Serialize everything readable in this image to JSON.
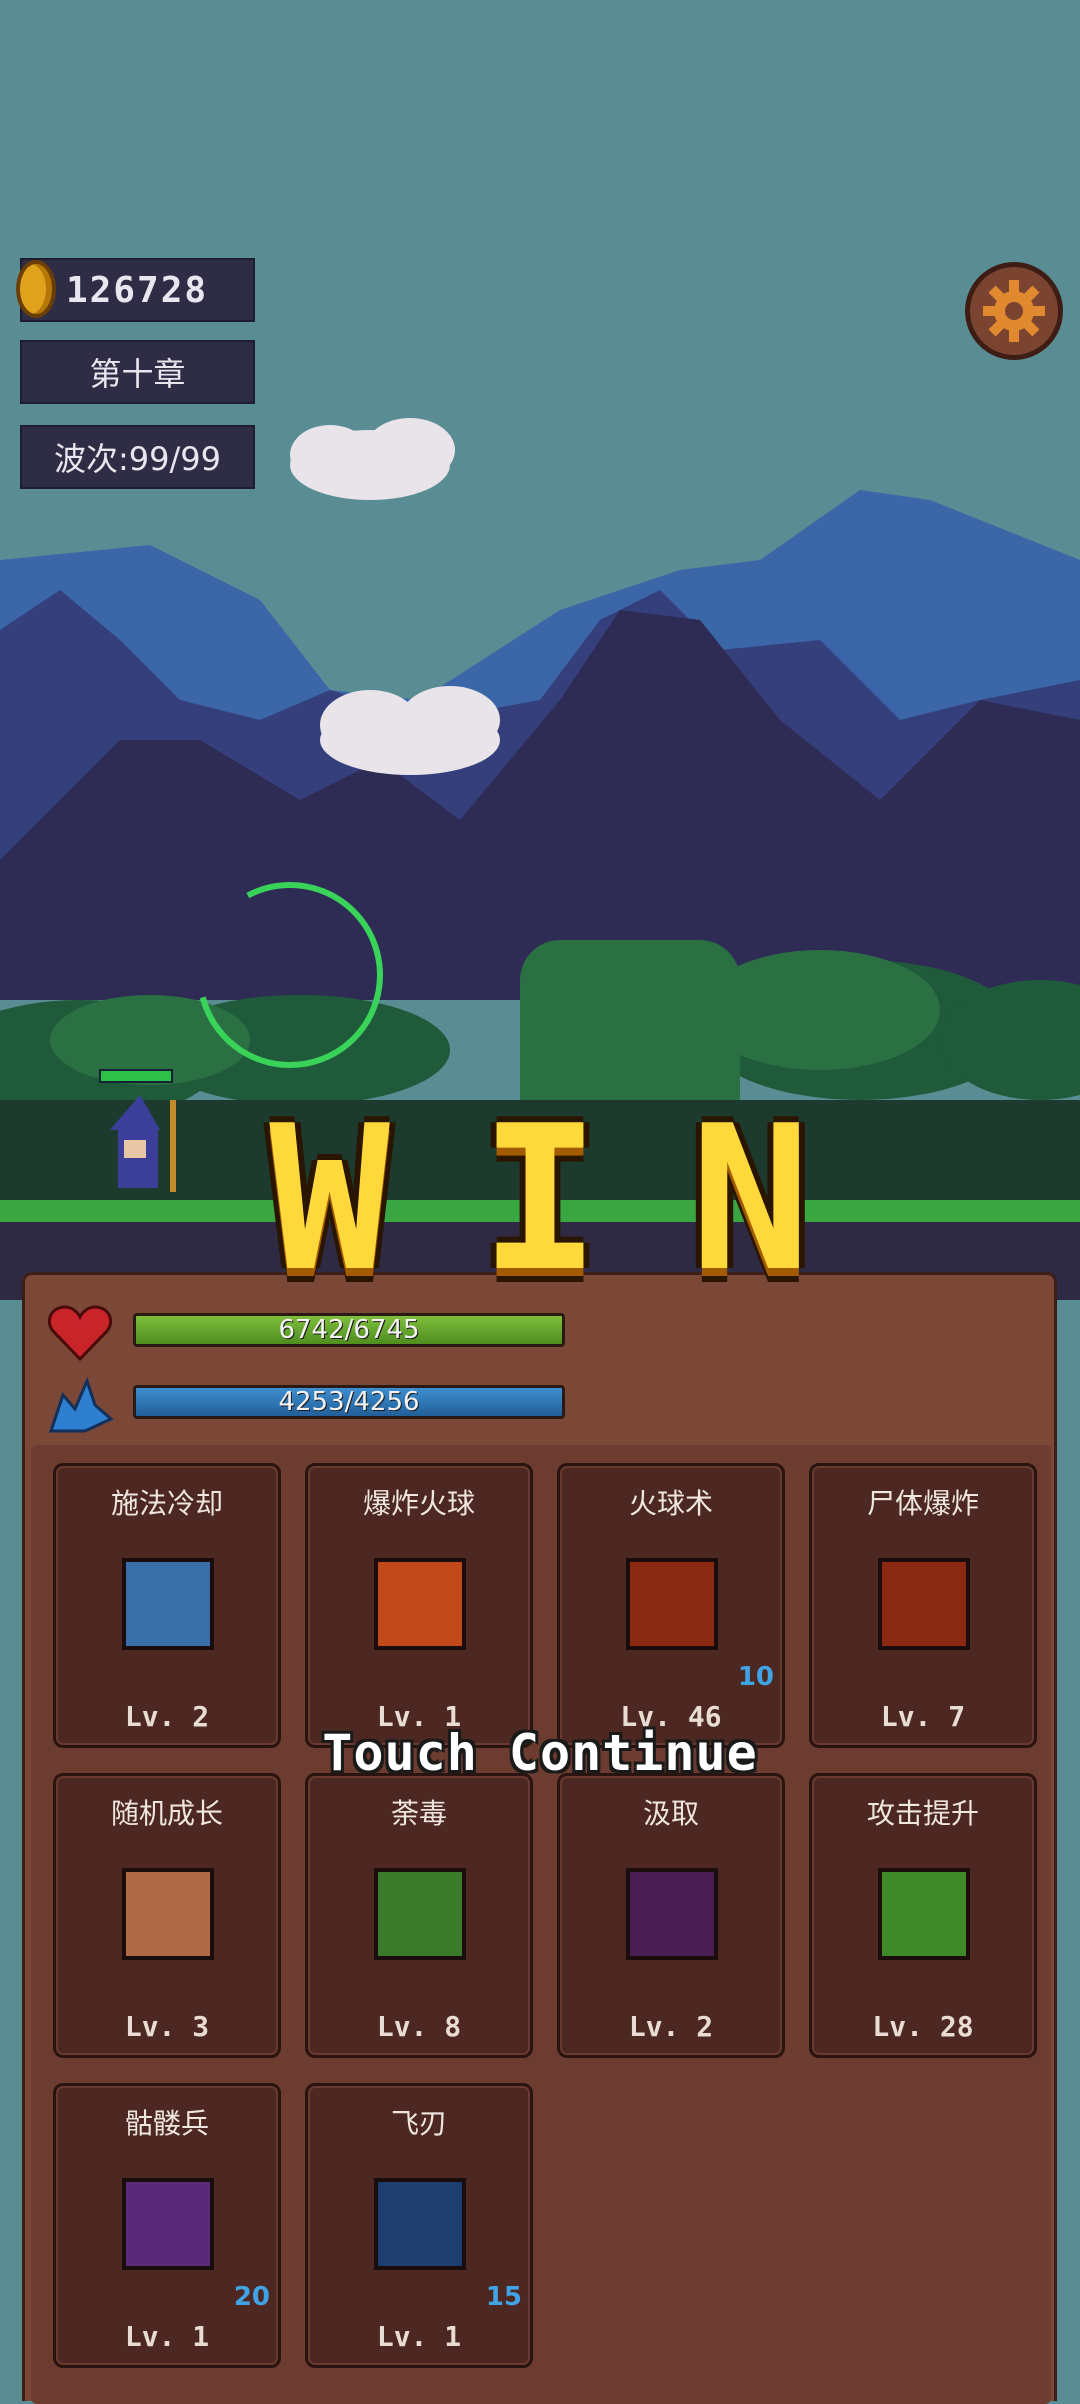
{
  "hud": {
    "coins": "126728",
    "chapter": "第十章",
    "wave": "波次:99/99"
  },
  "banner": {
    "letters": [
      "W",
      "I",
      "N"
    ]
  },
  "stats": {
    "hp": "6742/6745",
    "hp_fraction": 0.9996,
    "mp": "4253/4256",
    "mp_fraction": 0.9993
  },
  "skills": [
    {
      "name": "施法冷却",
      "level": "Lv. 2",
      "count": "",
      "icon": "lightning-icon",
      "color": "#3a6ea8"
    },
    {
      "name": "爆炸火球",
      "level": "Lv. 1",
      "count": "",
      "icon": "fire-explosion-icon",
      "color": "#c0481b"
    },
    {
      "name": "火球术",
      "level": "Lv. 46",
      "count": "10",
      "icon": "fireball-icon",
      "color": "#8a2a14"
    },
    {
      "name": "尸体爆炸",
      "level": "Lv. 7",
      "count": "",
      "icon": "corpse-explosion-icon",
      "color": "#8b2a14"
    },
    {
      "name": "随机成长",
      "level": "Lv. 3",
      "count": "",
      "icon": "fist-icon",
      "color": "#b06a45"
    },
    {
      "name": "荼毒",
      "level": "Lv. 8",
      "count": "",
      "icon": "poison-icon",
      "color": "#3b7a2a"
    },
    {
      "name": "汲取",
      "level": "Lv. 2",
      "count": "",
      "icon": "drain-spiral-icon",
      "color": "#4a1e52"
    },
    {
      "name": "攻击提升",
      "level": "Lv. 28",
      "count": "",
      "icon": "arrow-up-icon",
      "color": "#3e8a28"
    },
    {
      "name": "骷髅兵",
      "level": "Lv. 1",
      "count": "20",
      "icon": "skeleton-hand-icon",
      "color": "#5a2a78"
    },
    {
      "name": "飞刃",
      "level": "Lv. 1",
      "count": "15",
      "icon": "flying-blade-icon",
      "color": "#1e3f6e"
    }
  ],
  "touch_continue": "Touch Continue"
}
